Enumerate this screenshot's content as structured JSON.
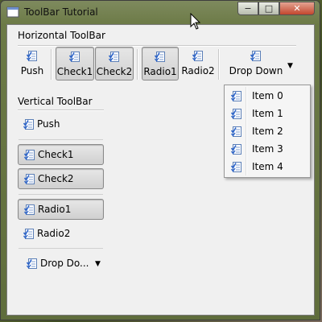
{
  "window": {
    "title": "ToolBar Tutorial",
    "controls": {
      "minimize": "−",
      "maximize": "□",
      "close": "✕"
    }
  },
  "horizontal_toolbar": {
    "title": "Horizontal ToolBar",
    "buttons": [
      {
        "label": "Push",
        "checked": false
      },
      {
        "label": "Check1",
        "checked": true
      },
      {
        "label": "Check2",
        "checked": true
      },
      {
        "label": "Radio1",
        "checked": true
      },
      {
        "label": "Radio2",
        "checked": false
      },
      {
        "label": "Drop Down",
        "checked": false
      }
    ],
    "dropdown_arrow": "▼"
  },
  "vertical_toolbar": {
    "title": "Vertical ToolBar",
    "buttons": [
      {
        "label": "Push",
        "checked": false
      },
      {
        "label": "Check1",
        "checked": true
      },
      {
        "label": "Check2",
        "checked": true
      },
      {
        "label": "Radio1",
        "checked": true
      },
      {
        "label": "Radio2",
        "checked": false
      },
      {
        "label": "Drop Do...",
        "checked": false
      }
    ],
    "dropdown_arrow": "▼"
  },
  "dropdown_menu": {
    "items": [
      "Item 0",
      "Item 1",
      "Item 2",
      "Item 3",
      "Item 4"
    ]
  },
  "icons": {
    "button_icon": "checklist-icon",
    "app_icon": "app-icon"
  },
  "colors": {
    "client_bg": "#f0f0f0",
    "close_button": "#c3462d",
    "icon_blue": "#2a62c9"
  }
}
